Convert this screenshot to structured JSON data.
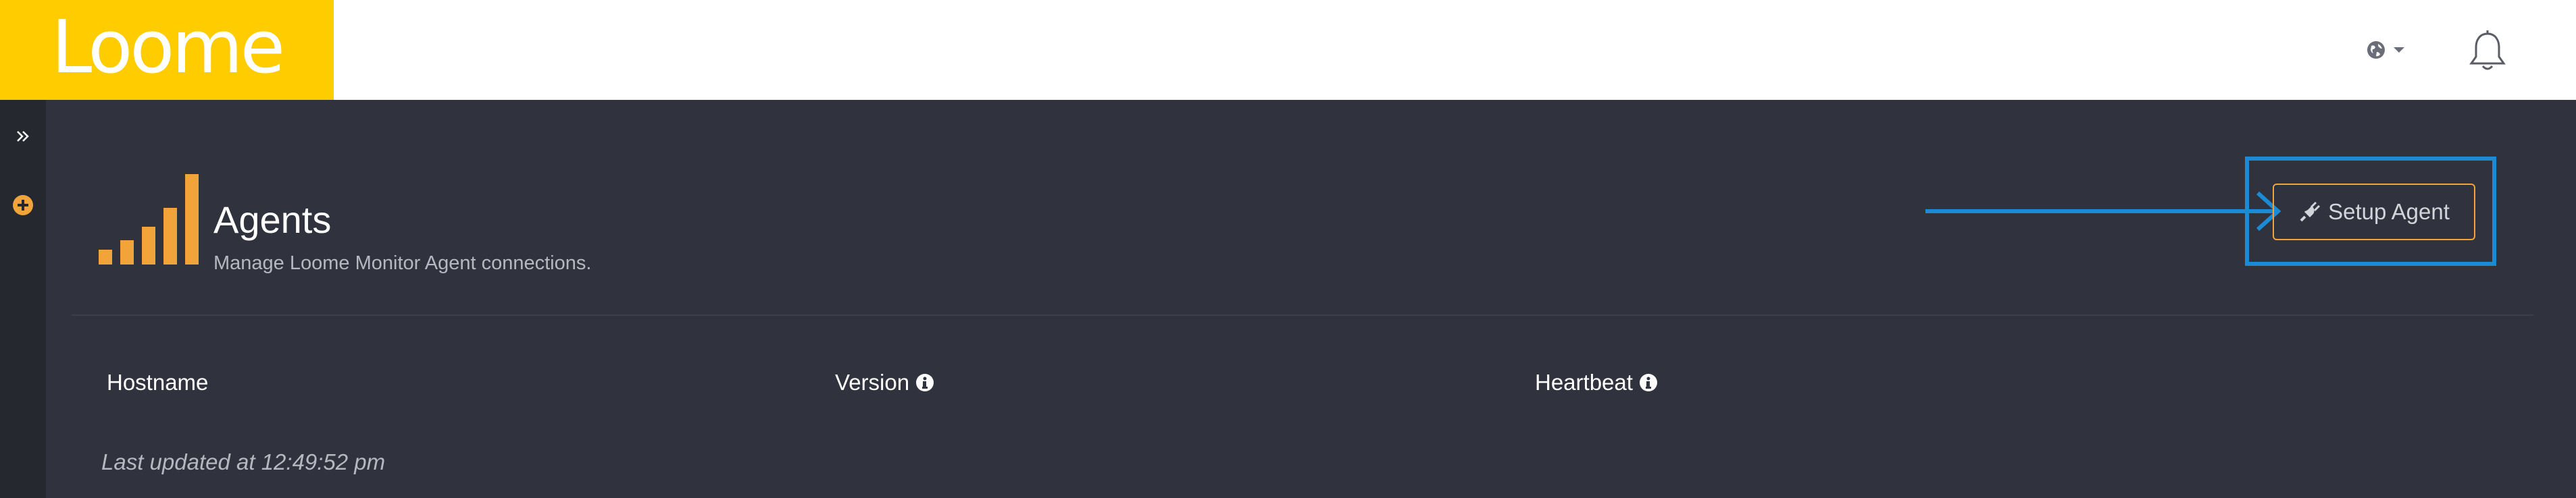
{
  "app": {
    "logo_text": "Loome"
  },
  "topbar": {
    "language_icon": "globe-icon",
    "notifications_icon": "bell-icon"
  },
  "sidebar": {
    "expand_icon": "double-chevron-right-icon",
    "add_icon": "plus-circle-icon"
  },
  "page": {
    "title": "Agents",
    "subtitle": "Manage Loome Monitor Agent connections.",
    "header_icon": "signal-bars-icon"
  },
  "actions": {
    "setup_agent_label": "Setup Agent",
    "setup_agent_icon": "plug-icon"
  },
  "table": {
    "columns": [
      {
        "label": "Hostname",
        "info": false
      },
      {
        "label": "Version",
        "info": true
      },
      {
        "label": "Heartbeat",
        "info": true
      }
    ]
  },
  "status": {
    "last_updated": "Last updated at 12:49:52 pm"
  },
  "colors": {
    "brand_yellow": "#ffcc00",
    "accent_orange": "#f0a43a",
    "annotation_blue": "#1b8bd6",
    "background": "#30333d"
  }
}
